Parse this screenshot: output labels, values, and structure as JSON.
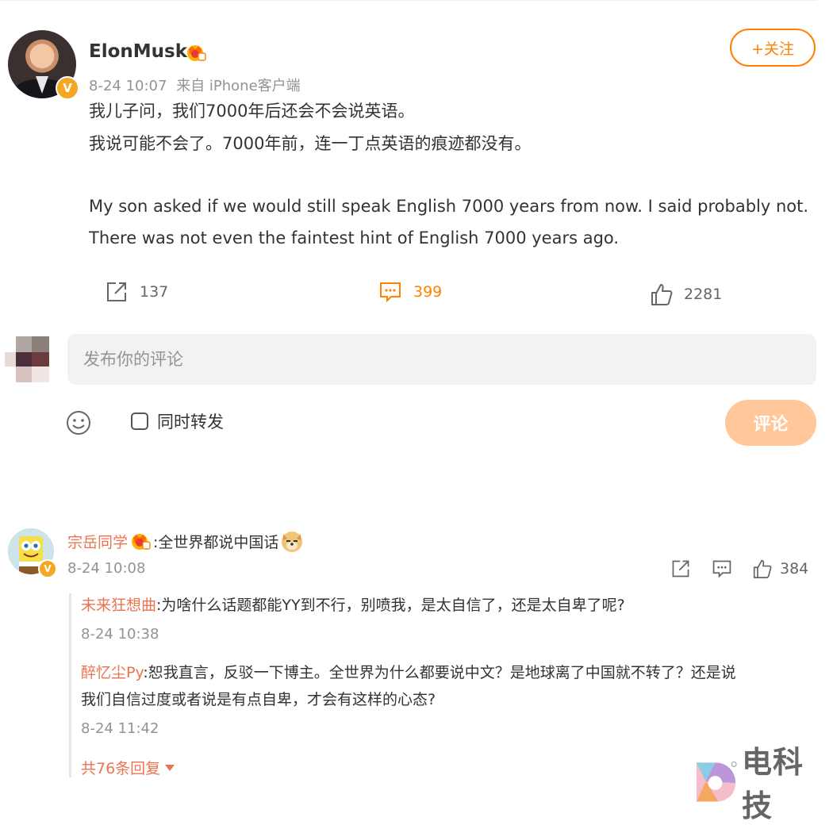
{
  "post": {
    "author": "ElonMusk",
    "verified_mark": "V",
    "time": "8-24 10:07",
    "source": "来自 iPhone客户端",
    "follow_label": "+关注",
    "text_line1": "我儿子问，我们7000年后还会不会说英语。",
    "text_line2": "我说可能不会了。7000年前，连一丁点英语的痕迹都没有。",
    "text_en": "My son asked if we would still speak English 7000 years from now. I said probably not. There was not even the faintest hint of English 7000 years ago."
  },
  "actions": {
    "repost_count": "137",
    "comment_count": "399",
    "like_count": "2281"
  },
  "composer": {
    "placeholder": "发布你的评论",
    "repost_label": "同时转发",
    "submit_label": "评论"
  },
  "comment": {
    "author": "宗岳同学",
    "text": ":全世界都说中国话",
    "time": "8-24 10:08",
    "like_count": "384",
    "replies": [
      {
        "author": "未来狂想曲",
        "text": ":为啥什么话题都能YY到不行，别喷我，是太自信了，还是太自卑了呢?",
        "time": "8-24 10:38"
      },
      {
        "author": "醉忆尘Py",
        "text_line1": ":恕我直言，反驳一下博主。全世界为什么都要说中文？是地球离了中国就不转了？还是说",
        "text_line2": "我们自信过度或者说是有点自卑，才会有这样的心态?",
        "time": "8-24 11:42"
      }
    ],
    "more_replies": "共76条回复"
  },
  "watermark": "电科技",
  "colors": {
    "accent": "#ff8200",
    "name": "#eb7350",
    "muted": "#939393",
    "submit_disabled": "#ffc79a"
  },
  "icons": [
    "repost-icon",
    "comment-icon",
    "like-icon",
    "emoji-icon",
    "crown-badge-icon",
    "doge-emoji-icon",
    "chevron-down-icon"
  ]
}
